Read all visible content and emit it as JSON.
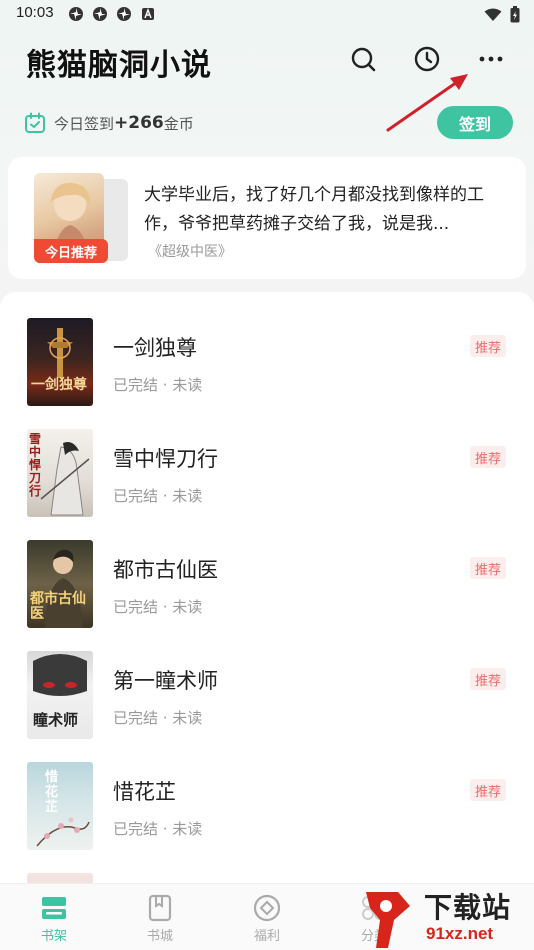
{
  "status_bar": {
    "time": "10:03",
    "left_icons": [
      "pinwheel-icon",
      "pinwheel-icon",
      "pinwheel-icon",
      "a-icon"
    ],
    "right_icons": [
      "wifi-icon",
      "battery-icon"
    ]
  },
  "header": {
    "title": "熊猫脑洞小说",
    "icons": [
      "search-icon",
      "history-icon",
      "more-icon"
    ]
  },
  "checkin": {
    "prefix": "今日签到",
    "amount": "+266",
    "unit": "金币",
    "button_label": "签到"
  },
  "recommend": {
    "badge": "今日推荐",
    "description": "大学毕业后，找了好几个月都没找到像样的工作，爷爷把草药摊子交给了我，说是我...",
    "book_title": "《超级中医》"
  },
  "books": [
    {
      "title": "一剑独尊",
      "status": "已完结 · 未读",
      "tag": "推荐",
      "cover_text": "一剑独尊"
    },
    {
      "title": "雪中悍刀行",
      "status": "已完结 · 未读",
      "tag": "推荐",
      "cover_text": "雪中悍刀行"
    },
    {
      "title": "都市古仙医",
      "status": "已完结 · 未读",
      "tag": "推荐",
      "cover_text": "都市古仙医"
    },
    {
      "title": "第一瞳术师",
      "status": "已完结 · 未读",
      "tag": "推荐",
      "cover_text": "瞳术师"
    },
    {
      "title": "惜花芷",
      "status": "已完结 · 未读",
      "tag": "推荐",
      "cover_text": "惜花芷"
    }
  ],
  "bottom_nav": [
    {
      "label": "书架",
      "icon": "bookshelf-icon",
      "active": true
    },
    {
      "label": "书城",
      "icon": "bookstore-icon",
      "active": false
    },
    {
      "label": "福利",
      "icon": "welfare-icon",
      "active": false
    },
    {
      "label": "分类",
      "icon": "category-icon",
      "active": false
    }
  ],
  "watermark": {
    "line1": "下载站",
    "line2": "91xz.net"
  },
  "colors": {
    "accent": "#3ec4a1",
    "badge_red": "#ef4a33",
    "tag_red": "#ef6a6a",
    "arrow_red": "#d0202a"
  }
}
